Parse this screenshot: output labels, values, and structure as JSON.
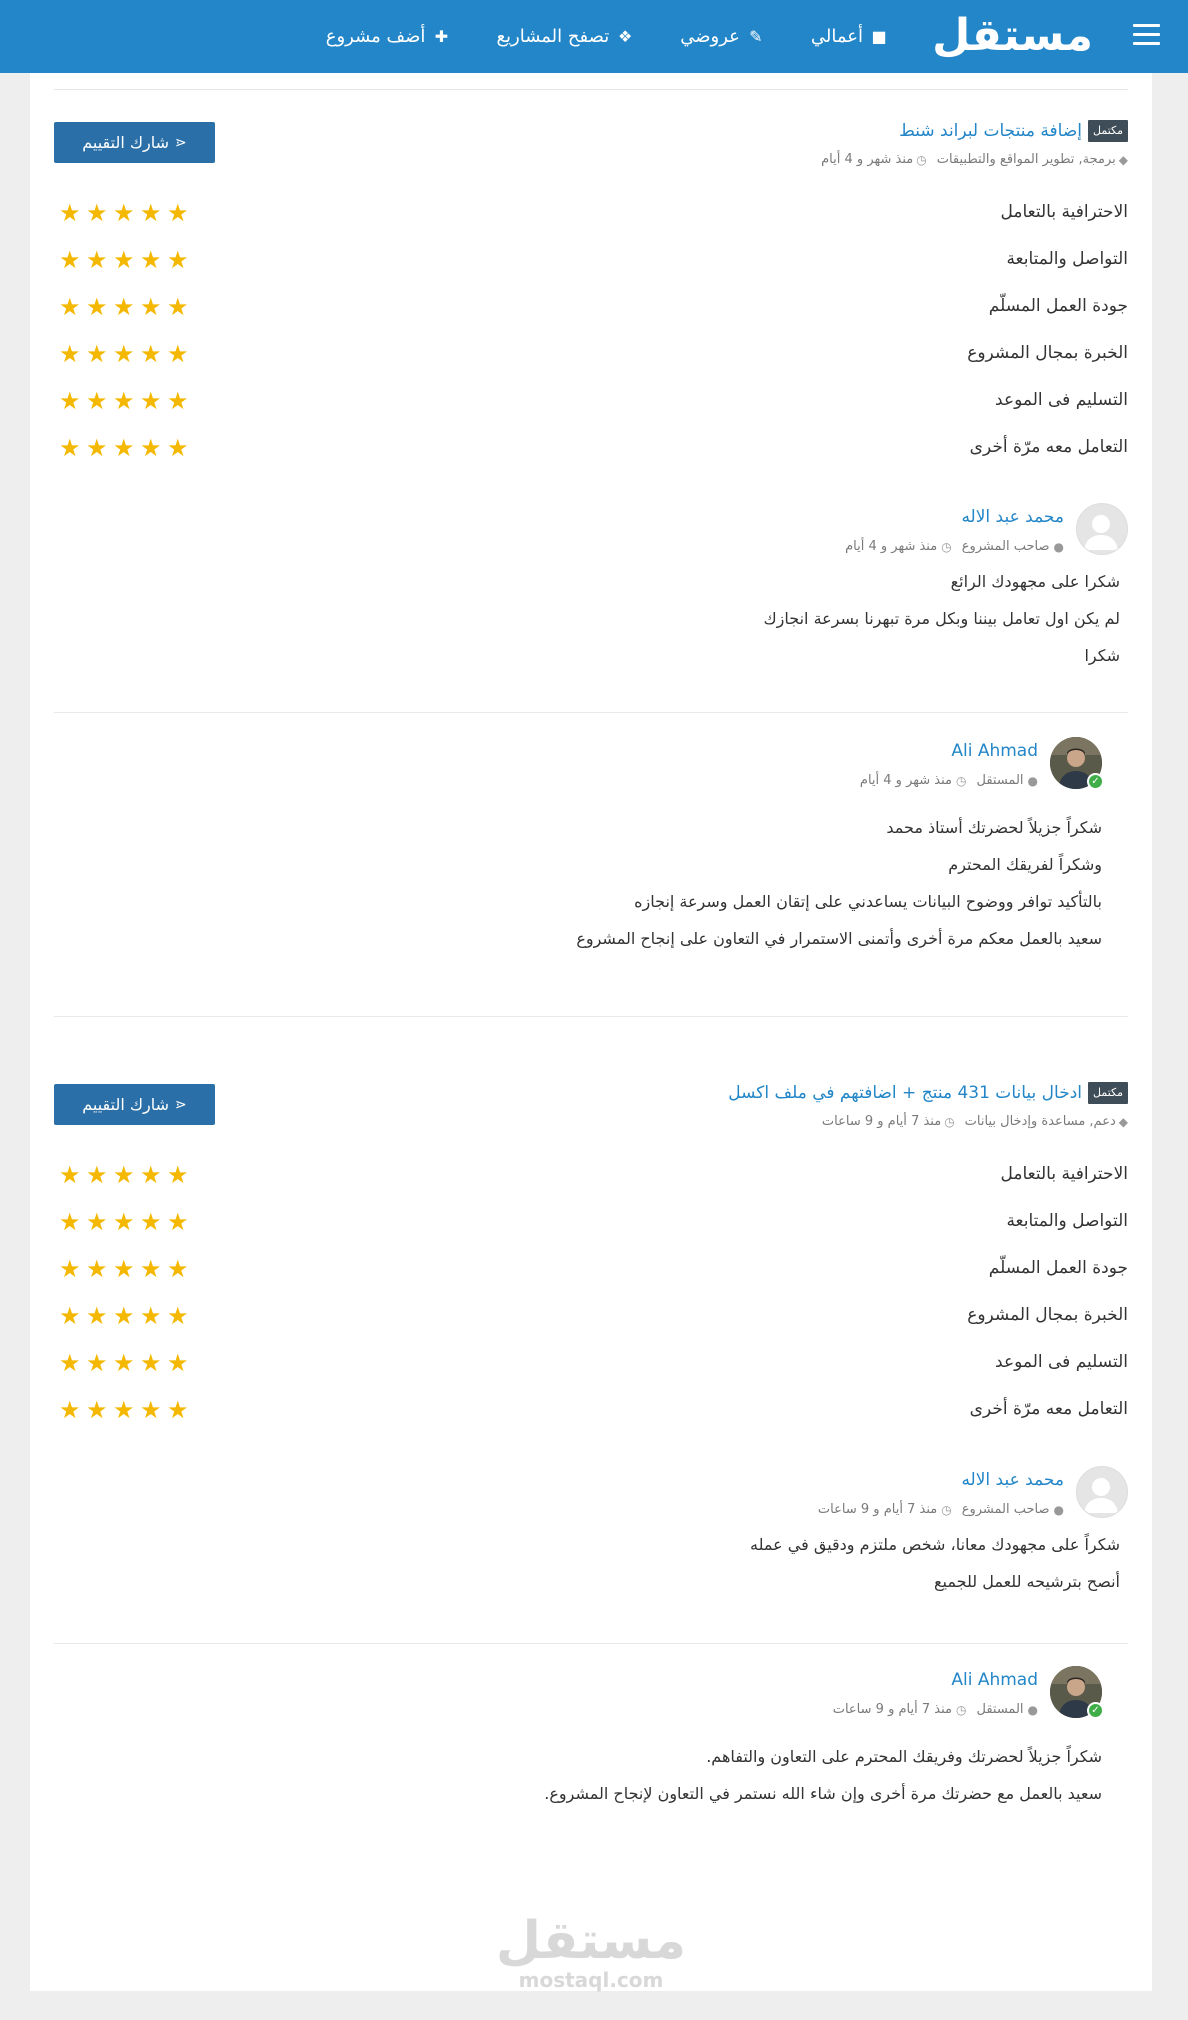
{
  "header": {
    "logo": "مستقل",
    "menu_icon": "hamburger-menu-icon",
    "nav": [
      {
        "label": "أضف مشروع",
        "icon": "plus-icon"
      },
      {
        "label": "تصفح المشاريع",
        "icon": "cubes-icon"
      },
      {
        "label": "عروضي",
        "icon": "ticket-icon"
      },
      {
        "label": "أعمالي",
        "icon": "briefcase-icon"
      }
    ]
  },
  "share_label": "شارك التقييم",
  "rating_labels": [
    "الاحترافية بالتعامل",
    "التواصل والمتابعة",
    "جودة العمل المسلّم",
    "الخبرة بمجال المشروع",
    "التسليم فى الموعد",
    "التعامل معه مرّة أخرى"
  ],
  "reviews": [
    {
      "badge": "مكتمل",
      "title": "إضافة منتجات لبراند شنط",
      "tags": "برمجة, تطوير المواقع والتطبيقات",
      "time": "منذ شهر و 4 أيام",
      "ratings": [
        5,
        5,
        5,
        5,
        5,
        5
      ],
      "owner_comment": {
        "name": "محمد عبد الاله",
        "role": "صاحب المشروع",
        "time": "منذ شهر و 4 أيام",
        "lines": [
          "شكرا على مجهودك الرائع",
          "لم يكن اول تعامل بيننا وبكل مرة تبهرنا بسرعة انجازك",
          "شكرا"
        ]
      },
      "freelancer_comment": {
        "name": "Ali Ahmad",
        "role": "المستقل",
        "time": "منذ شهر و 4 أيام",
        "lines": [
          "شكراً جزيلاً لحضرتك أستاذ محمد",
          "وشكراً لفريقك المحترم",
          "بالتأكيد توافر ووضوح البيانات يساعدني على إتقان العمل وسرعة إنجازه",
          "سعيد بالعمل معكم مرة أخرى وأتمنى الاستمرار في التعاون على إنجاح المشروع"
        ]
      }
    },
    {
      "badge": "مكتمل",
      "title": "ادخال بيانات 431 منتج + اضافتهم في ملف اكسل",
      "tags": "دعم, مساعدة وإدخال بيانات",
      "time": "منذ 7 أيام و 9 ساعات",
      "ratings": [
        5,
        5,
        5,
        5,
        5,
        5
      ],
      "owner_comment": {
        "name": "محمد عبد الاله",
        "role": "صاحب المشروع",
        "time": "منذ 7 أيام و 9 ساعات",
        "lines": [
          "شكراً على مجهودك معانا، شخص ملتزم ودقيق في عمله",
          "أنصح بترشيحه للعمل للجميع"
        ]
      },
      "freelancer_comment": {
        "name": "Ali Ahmad",
        "role": "المستقل",
        "time": "منذ 7 أيام و 9 ساعات",
        "lines": [
          "شكراً جزيلاً لحضرتك وفريقك المحترم على التعاون والتفاهم.",
          "سعيد بالعمل مع حضرتك مرة أخرى وإن شاء الله نستمر في التعاون لإنجاح المشروع."
        ]
      }
    }
  ],
  "footer": {
    "logo": "مستقل",
    "domain": "mostaql.com"
  },
  "colors": {
    "brand": "#2386c8",
    "share_button": "#2a6fa8",
    "star": "#f5b800",
    "badge": "#3f4d58",
    "verified": "#3fae49"
  }
}
